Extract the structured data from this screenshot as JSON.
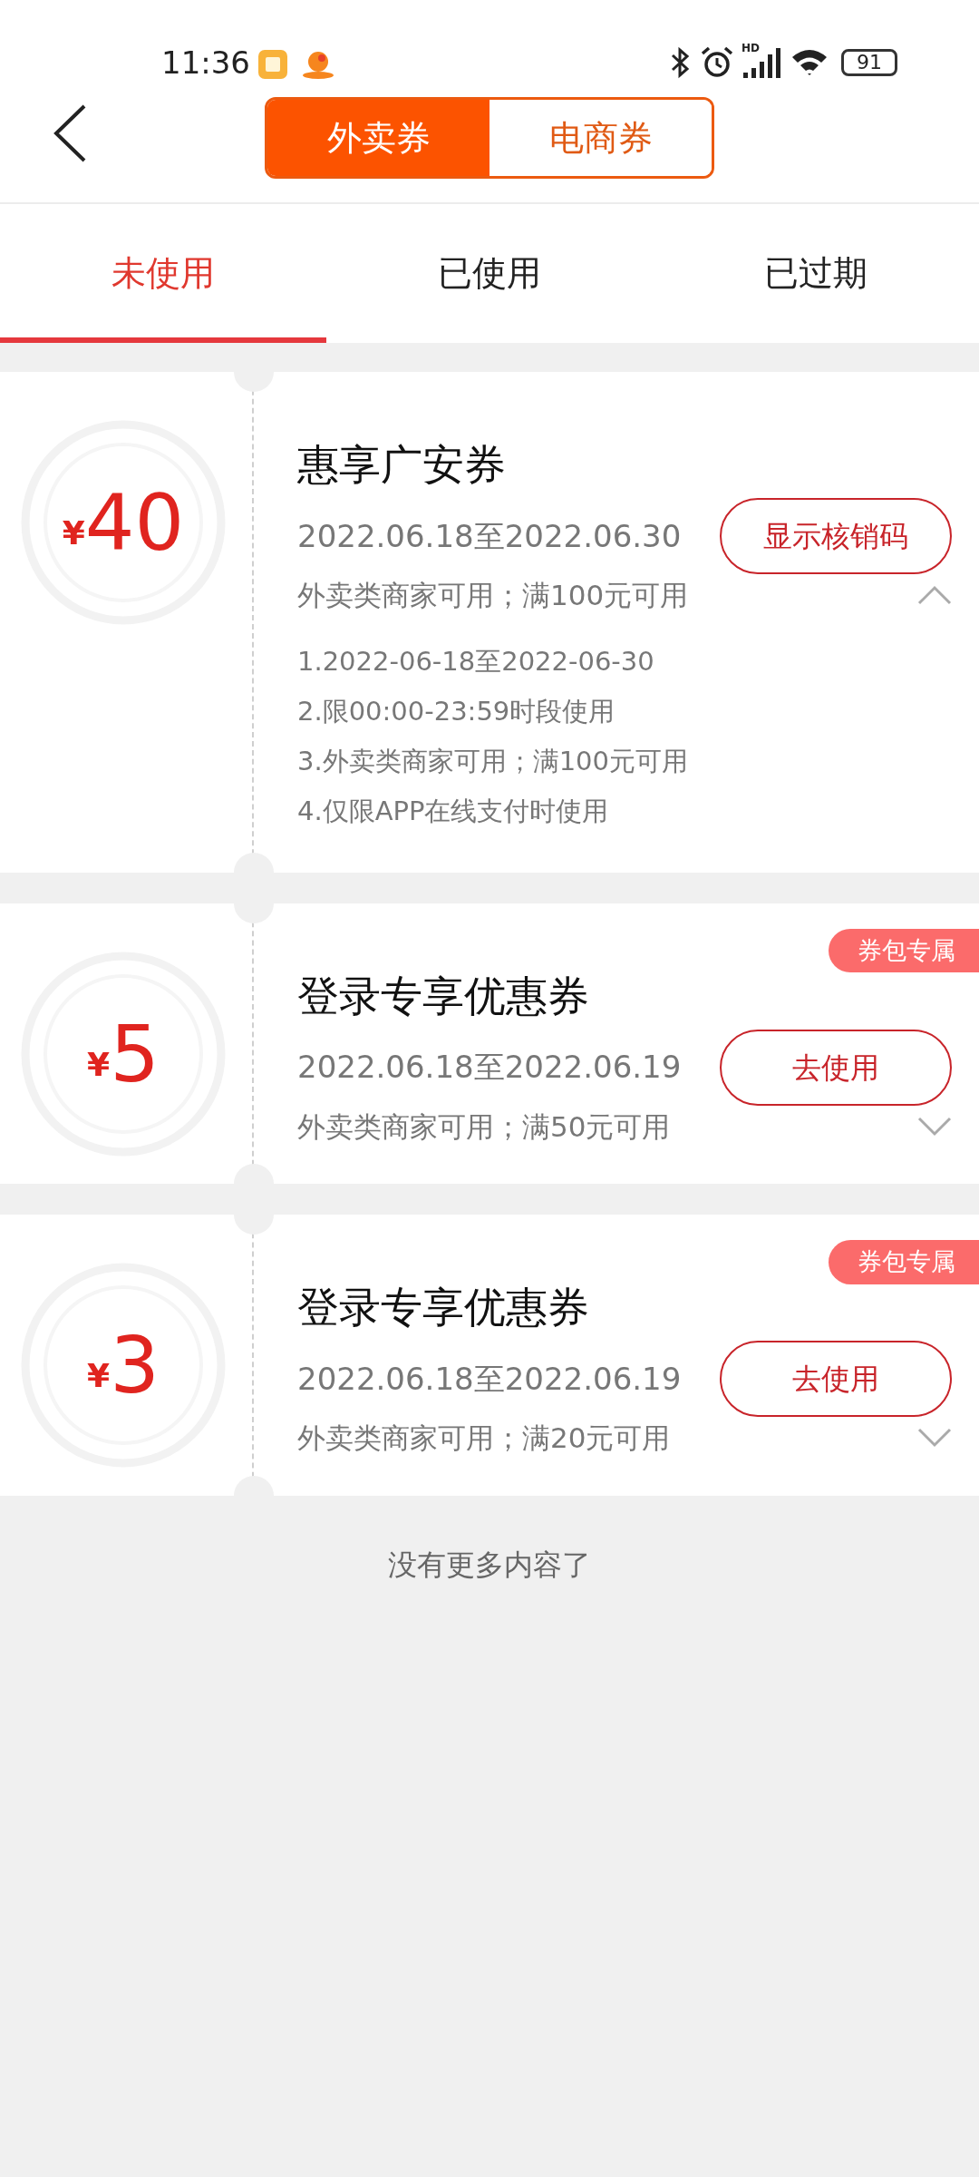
{
  "status_bar": {
    "time": "11:36",
    "network_label": "HD",
    "battery": "91"
  },
  "segments": [
    {
      "label": "外卖券",
      "selected": true
    },
    {
      "label": "电商券",
      "selected": false
    }
  ],
  "tabs": [
    {
      "label": "未使用",
      "selected": true
    },
    {
      "label": "已使用",
      "selected": false
    },
    {
      "label": "已过期",
      "selected": false
    }
  ],
  "coupons": [
    {
      "currency": "¥",
      "amount": "40",
      "title": "惠享广安券",
      "validity": "2022.06.18至2022.06.30",
      "condition": "外卖类商家可用；满100元可用",
      "button": "显示核销码",
      "expanded": true,
      "details": [
        "1.2022-06-18至2022-06-30",
        "2.限00:00-23:59时段使用",
        "3.外卖类商家可用；满100元可用",
        "4.仅限APP在线支付时使用"
      ]
    },
    {
      "currency": "¥",
      "amount": "5",
      "tag": "券包专属",
      "title": "登录专享优惠券",
      "validity": "2022.06.18至2022.06.19",
      "condition": "外卖类商家可用；满50元可用",
      "button": "去使用",
      "expanded": false
    },
    {
      "currency": "¥",
      "amount": "3",
      "tag": "券包专属",
      "title": "登录专享优惠券",
      "validity": "2022.06.18至2022.06.19",
      "condition": "外卖类商家可用；满20元可用",
      "button": "去使用",
      "expanded": false
    }
  ],
  "footer": "没有更多内容了"
}
